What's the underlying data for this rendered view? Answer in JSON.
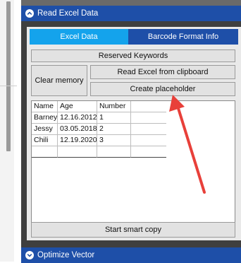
{
  "sections": {
    "read_excel": {
      "title": "Read Excel Data"
    },
    "optimize_vector": {
      "title": "Optimize Vector"
    }
  },
  "tabs": [
    {
      "label": "Excel Data",
      "active": true
    },
    {
      "label": "Barcode Format Info",
      "active": false
    }
  ],
  "buttons": {
    "reserved_keywords": "Reserved Keywords",
    "clear_memory": "Clear memory",
    "read_clipboard": "Read Excel from clipboard",
    "create_placeholder": "Create placeholder",
    "start_smart_copy": "Start smart copy"
  },
  "table": {
    "columns": [
      "Name",
      "Age",
      "Number"
    ],
    "rows": [
      [
        "Barney",
        "12.16.2012",
        "1"
      ],
      [
        "Jessy",
        "03.05.2018",
        "2"
      ],
      [
        "Chili",
        "12.19.2020",
        "3"
      ]
    ]
  },
  "colors": {
    "header_blue": "#1e4fa8",
    "active_tab": "#14a3ec",
    "annotation_arrow": "#e8403a"
  },
  "icons": {
    "section_toggle": "chevron-circle-icon"
  }
}
